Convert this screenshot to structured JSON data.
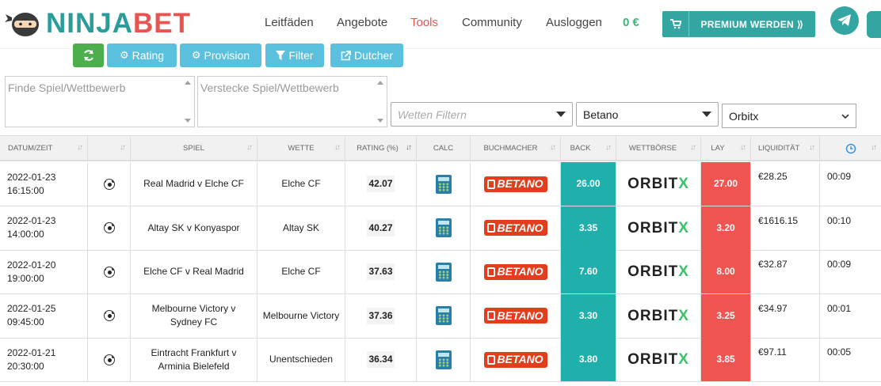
{
  "header": {
    "logo_ninja": "NINJA",
    "logo_bet": "BET",
    "nav": [
      {
        "label": "Leitfäden",
        "active": false
      },
      {
        "label": "Angebote",
        "active": false
      },
      {
        "label": "Tools",
        "active": true
      },
      {
        "label": "Community",
        "active": false
      },
      {
        "label": "Ausloggen",
        "active": false
      }
    ],
    "balance": "0 €",
    "premium_label": "PREMIUM WERDEN ⟫"
  },
  "toolbar": {
    "refresh_icon": "refresh-icon",
    "rating_label": "Rating",
    "provision_label": "Provision",
    "filter_label": "Filter",
    "dutcher_label": "Dutcher"
  },
  "filters": {
    "find_placeholder": "Finde Spiel/Wettbewerb",
    "hide_placeholder": "Verstecke Spiel/Wettbewerb",
    "bets_placeholder": "Wetten Filtern",
    "bookmaker_selected": "Betano",
    "exchange_selected": "Orbitx"
  },
  "colors": {
    "brand_teal": "#33a6a2",
    "brand_red": "#e8554e",
    "back": "#1fb0ac",
    "lay": "#ef5451"
  },
  "table": {
    "headers": [
      "DATUM/ZEIT",
      "",
      "SPIEL",
      "WETTE",
      "RATING (%)",
      "CALC",
      "BUCHMACHER",
      "BACK",
      "WETTBÖRSE",
      "LAY",
      "LIQUIDITÄT",
      ""
    ],
    "rows": [
      {
        "date": "2022-01-23",
        "time": "16:15:00",
        "match": "Real Madrid v Elche CF",
        "bet": "Elche CF",
        "rating": "42.07",
        "back": "26.00",
        "lay": "27.00",
        "liquidity": "€28.25",
        "timer": "00:09"
      },
      {
        "date": "2022-01-23",
        "time": "14:00:00",
        "match": "Altay SK v Konyaspor",
        "bet": "Altay SK",
        "rating": "40.27",
        "back": "3.35",
        "lay": "3.20",
        "liquidity": "€1616.15",
        "timer": "00:10"
      },
      {
        "date": "2022-01-20",
        "time": "19:00:00",
        "match": "Elche CF v Real Madrid",
        "bet": "Elche CF",
        "rating": "37.63",
        "back": "7.60",
        "lay": "8.00",
        "liquidity": "€32.87",
        "timer": "00:09"
      },
      {
        "date": "2022-01-25",
        "time": "09:45:00",
        "match": "Melbourne Victory v Sydney FC",
        "bet": "Melbourne Victory",
        "rating": "37.36",
        "back": "3.30",
        "lay": "3.25",
        "liquidity": "€34.97",
        "timer": "00:01"
      },
      {
        "date": "2022-01-21",
        "time": "20:30:00",
        "match": "Eintracht Frankfurt v Arminia Bielefeld",
        "bet": "Unentschieden",
        "rating": "36.34",
        "back": "3.80",
        "lay": "3.85",
        "liquidity": "€97.11",
        "timer": "00:05"
      }
    ],
    "bookmaker_logo": "BETANO",
    "exchange_logo_main": "ORBIT",
    "exchange_logo_x": "X"
  }
}
